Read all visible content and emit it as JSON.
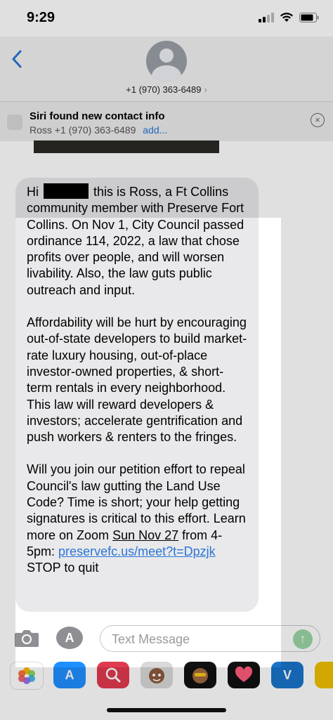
{
  "status_bar": {
    "time": "9:29"
  },
  "header": {
    "back_icon": "chevron-left-icon",
    "contact_number": "+1 (970) 363-6489",
    "contact_chevron": "›"
  },
  "siri_suggestion": {
    "title": "Siri found new contact info",
    "detail": "Ross +1 (970) 363-6489",
    "add_label": "add...",
    "close_icon": "×"
  },
  "message": {
    "p1_greeting": "Hi",
    "p1_after_redaction": "this is Ross, a Ft Collins community member with Preserve Fort Collins. On Nov 1, City Council passed ordinance 114, 2022, a law that chose profits over people, and will worsen livability. Also, the law guts public outreach and input.",
    "p2": "Affordability will be hurt by encouraging out-of-state developers to build market-rate luxury housing, out-of-place investor-owned properties, & short-term rentals in every neighborhood. This law will reward developers & investors; accelerate gentrification and push workers & renters to the fringes.",
    "p3_before": "Will you join our petition effort to repeal Council's law gutting the Land Use Code? Time is short; your help getting signatures is critical to this effort. Learn more on Zoom",
    "p3_date_underlined": "Sun Nov 27",
    "p3_time": "from 4-5pm:",
    "p3_link": "preservefc.us/meet?t=Dpzjk",
    "p3_after": "STOP to quit"
  },
  "composer": {
    "placeholder": "Text Message",
    "send_icon": "↑",
    "appstore_icon": "A"
  },
  "app_drawer": {
    "items": [
      "Photos",
      "App Store",
      "Search",
      "Memoji",
      "Memoji Stickers",
      "Digital Touch",
      "Venmo",
      "More"
    ],
    "venmo_glyph": "V"
  },
  "colors": {
    "link": "#2a75d6",
    "bubble": "#e9e9eb",
    "send": "#9bd6a4"
  }
}
